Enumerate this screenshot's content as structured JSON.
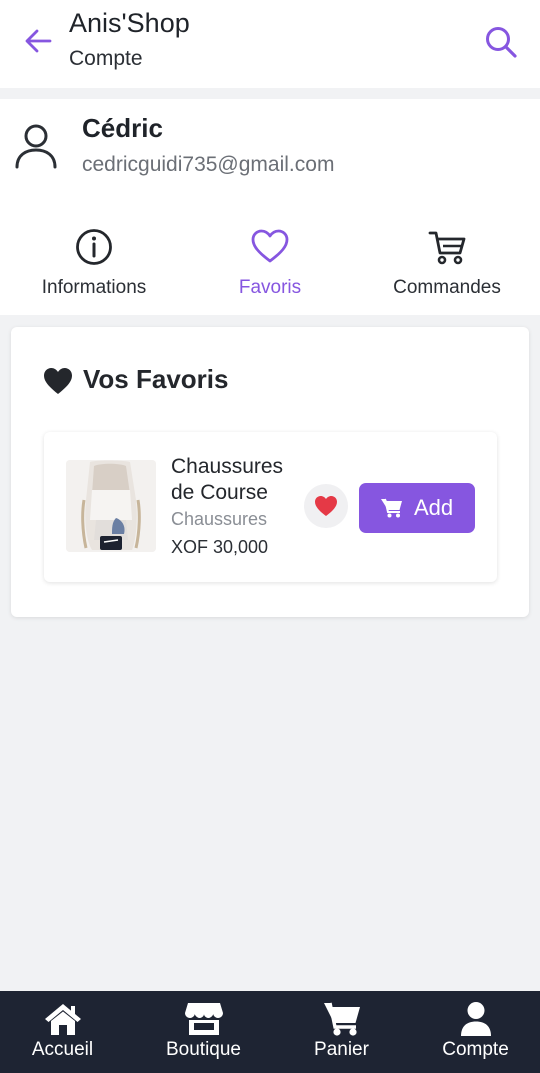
{
  "header": {
    "title": "Anis'Shop",
    "subtitle": "Compte",
    "back_icon": "arrow-left-icon",
    "search_icon": "search-icon"
  },
  "profile": {
    "name": "Cédric",
    "email": "cedricguidi735@gmail.com",
    "avatar_icon": "user-outline-icon"
  },
  "tabs": [
    {
      "label": "Informations",
      "icon": "info-circle-icon",
      "active": false
    },
    {
      "label": "Favoris",
      "icon": "heart-outline-icon",
      "active": true
    },
    {
      "label": "Commandes",
      "icon": "cart-icon",
      "active": false
    }
  ],
  "favorites": {
    "heading": "Vos Favoris",
    "heading_icon": "heart-icon",
    "items": [
      {
        "name": "Chaussures de Course",
        "category": "Chaussures",
        "price": "XOF 30,000",
        "favorite": true,
        "add_label": "Add"
      }
    ]
  },
  "bottom_nav": [
    {
      "label": "Accueil",
      "icon": "home-icon"
    },
    {
      "label": "Boutique",
      "icon": "store-icon"
    },
    {
      "label": "Panier",
      "icon": "cart-icon"
    },
    {
      "label": "Compte",
      "icon": "user-icon"
    }
  ],
  "colors": {
    "accent": "#8656e0",
    "nav_background": "#1e2433",
    "page_background": "#f1f2f4",
    "heart_red": "#e53946"
  }
}
